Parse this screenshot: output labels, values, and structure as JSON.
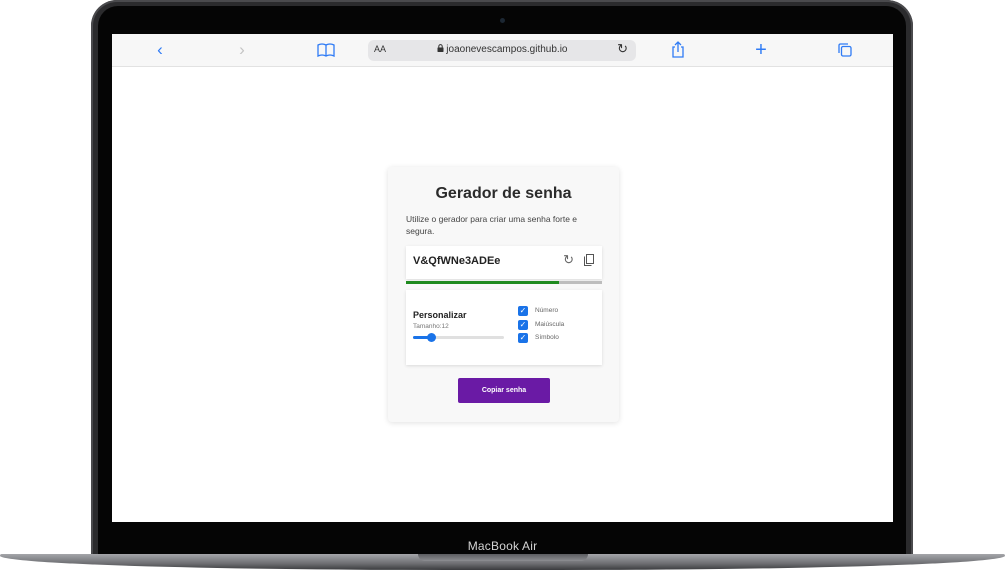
{
  "device": {
    "label": "MacBook Air"
  },
  "browser": {
    "text_size_button": "AA",
    "url": "joaonevescampos.github.io",
    "icons": [
      "back-icon",
      "forward-icon",
      "bookmarks-icon",
      "lock-icon",
      "reload-icon",
      "share-icon",
      "new-tab-icon",
      "tabs-icon"
    ]
  },
  "card": {
    "title": "Gerador de senha",
    "description": "Utilize o gerador para criar uma senha forte e segura.",
    "password": "V&QfWNe3ADEe",
    "strength": 0.78,
    "strength_color": "#1e8a1e",
    "customize": {
      "title": "Personalizar",
      "size_label": "Tamanho:12",
      "size_value": 12,
      "size_fraction": 0.2,
      "options": [
        {
          "label": "Número",
          "checked": true
        },
        {
          "label": "Maiúscula",
          "checked": true
        },
        {
          "label": "Símbolo",
          "checked": true
        }
      ]
    },
    "copy_button": "Copiar senha",
    "accent_color": "#6a1aa5",
    "check_color": "#1a73e8"
  }
}
